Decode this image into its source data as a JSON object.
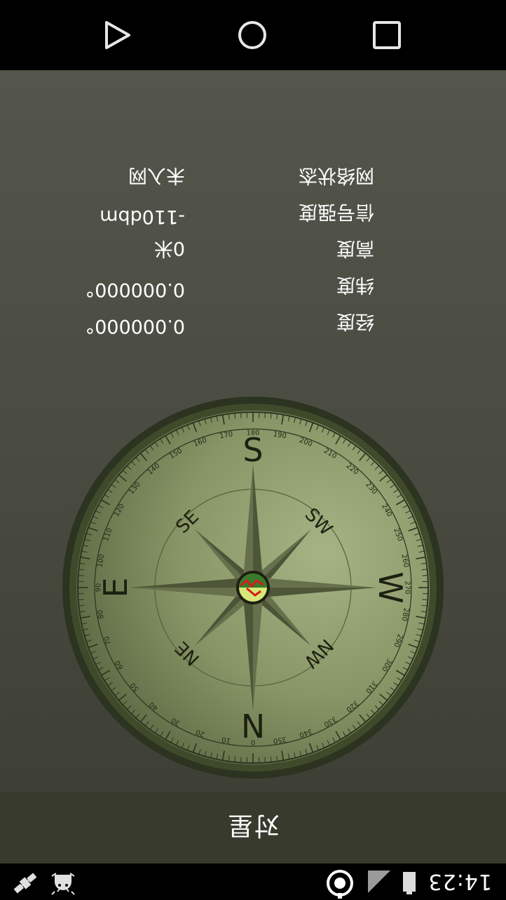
{
  "status_bar": {
    "time": "14:23",
    "icons": [
      "gps-target-icon",
      "signal-icon",
      "battery-icon",
      "satellite-icon",
      "android-debug-icon"
    ]
  },
  "title_bar": {
    "title": "对星"
  },
  "compass": {
    "cardinals": {
      "N": "N",
      "E": "E",
      "S": "S",
      "W": "W"
    },
    "intercardinals": {
      "NE": "NE",
      "SE": "SE",
      "SW": "SW",
      "NW": "NW"
    },
    "degree_labels": [
      "0",
      "10",
      "20",
      "30",
      "40",
      "50",
      "60",
      "70",
      "80",
      "90",
      "100",
      "110",
      "120",
      "130",
      "140",
      "150",
      "160",
      "170",
      "180",
      "190",
      "200",
      "210",
      "220",
      "230",
      "240",
      "250",
      "260",
      "270",
      "280",
      "290",
      "300",
      "310",
      "320",
      "330",
      "340",
      "350"
    ]
  },
  "info": {
    "rows": [
      {
        "label": "经度",
        "value": "0.000000°"
      },
      {
        "label": "纬度",
        "value": "0.000000°"
      },
      {
        "label": "高度",
        "value": "0米"
      },
      {
        "label": "信号强度",
        "value": "-110dbm"
      },
      {
        "label": "网络状态",
        "value": "未入网"
      }
    ]
  },
  "nav_bar": {
    "buttons": [
      "back-button",
      "home-button",
      "recents-button"
    ]
  },
  "colors": {
    "title_bg": "#383a2e",
    "main_bg": "#4a4c42",
    "compass_ring": "#3b4427",
    "compass_face": "#a7b486",
    "needle_red": "#d71a1a"
  }
}
